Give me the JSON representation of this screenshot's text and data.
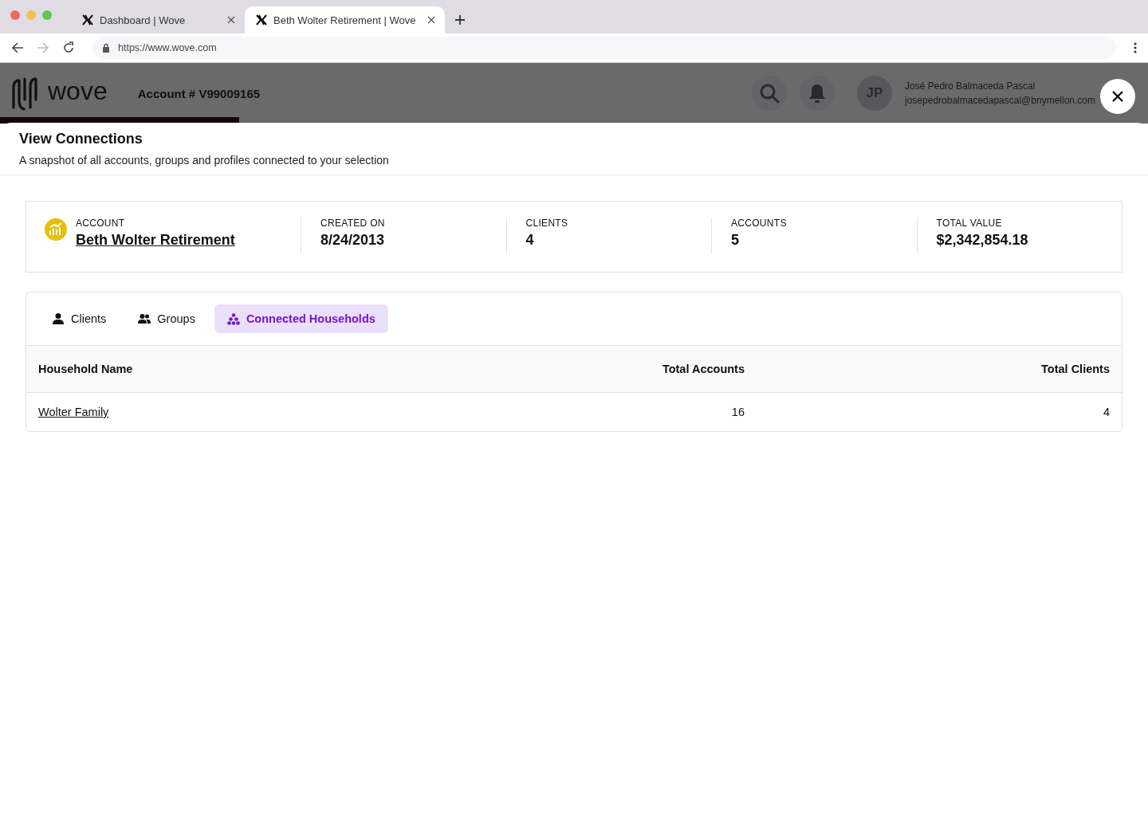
{
  "browser": {
    "tabs": [
      {
        "title": "Dashboard | Wove",
        "selected": false
      },
      {
        "title": "Beth Wolter Retirement | Wove",
        "selected": true
      }
    ],
    "url": "https://www.wove.com"
  },
  "app_header": {
    "logo": "wove",
    "account": "Account # V99009165",
    "user": {
      "initials": "JP",
      "name": "José Pedro Balmaceda Pascal",
      "email": "josepedrobalmacedapascal@bnymellon.com"
    }
  },
  "modal": {
    "title": "View Connections",
    "subtitle": "A snapshot of all accounts, groups and profiles connected to your selection",
    "summary": [
      {
        "label": "ACCOUNT",
        "value": "Beth Wolter Retirement",
        "kind": "link"
      },
      {
        "label": "CREATED ON",
        "value": "8/24/2013",
        "kind": "plain"
      },
      {
        "label": "CLIENTS",
        "value": "4",
        "kind": "plain"
      },
      {
        "label": "ACCOUNTS",
        "value": "5",
        "kind": "plain"
      },
      {
        "label": "TOTAL VALUE",
        "value": "$2,342,854.18",
        "kind": "plain"
      }
    ],
    "tabs": [
      {
        "label": "Clients",
        "kind": "person",
        "selected": false
      },
      {
        "label": "Groups",
        "kind": "people",
        "selected": false
      },
      {
        "label": "Connected Households",
        "kind": "cluster",
        "selected": true
      }
    ],
    "table": {
      "columns": [
        "Household Name",
        "Total Accounts",
        "Total Clients"
      ],
      "rows": [
        [
          "Wolter Family",
          "16",
          "4"
        ]
      ]
    }
  }
}
